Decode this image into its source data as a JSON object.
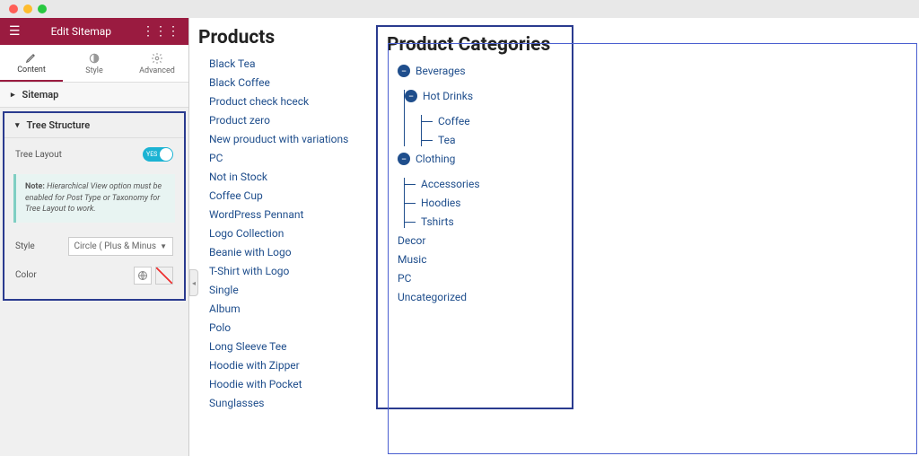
{
  "chrome": {},
  "header": {
    "title": "Edit Sitemap"
  },
  "tabs": {
    "content": "Content",
    "style": "Style",
    "advanced": "Advanced"
  },
  "accordion": {
    "sitemap": "Sitemap",
    "tree": "Tree Structure"
  },
  "controls": {
    "tree_layout_label": "Tree Layout",
    "toggle_value": "YES",
    "note_label": "Note:",
    "note_text": "Hierarchical View option must be enabled for Post Type or Taxonomy for Tree Layout to work.",
    "style_label": "Style",
    "style_value": "Circle ( Plus & Minus",
    "color_label": "Color"
  },
  "products": {
    "heading": "Products",
    "items": [
      "Black Tea",
      "Black Coffee",
      "Product check hceck",
      "Product zero",
      "New prouduct with variations",
      "PC",
      "Not in Stock",
      "Coffee Cup",
      "WordPress Pennant",
      "Logo Collection",
      "Beanie with Logo",
      "T-Shirt with Logo",
      "Single",
      "Album",
      "Polo",
      "Long Sleeve Tee",
      "Hoodie with Zipper",
      "Hoodie with Pocket",
      "Sunglasses"
    ]
  },
  "categories": {
    "heading": "Product Categories",
    "tree": [
      {
        "label": "Beverages",
        "expanded": true,
        "children": [
          {
            "label": "Hot Drinks",
            "expanded": true,
            "children": [
              {
                "label": "Coffee"
              },
              {
                "label": "Tea"
              }
            ]
          }
        ]
      },
      {
        "label": "Clothing",
        "expanded": true,
        "children": [
          {
            "label": "Accessories"
          },
          {
            "label": "Hoodies"
          },
          {
            "label": "Tshirts"
          }
        ]
      },
      {
        "label": "Decor"
      },
      {
        "label": "Music"
      },
      {
        "label": "PC"
      },
      {
        "label": "Uncategorized"
      }
    ]
  }
}
